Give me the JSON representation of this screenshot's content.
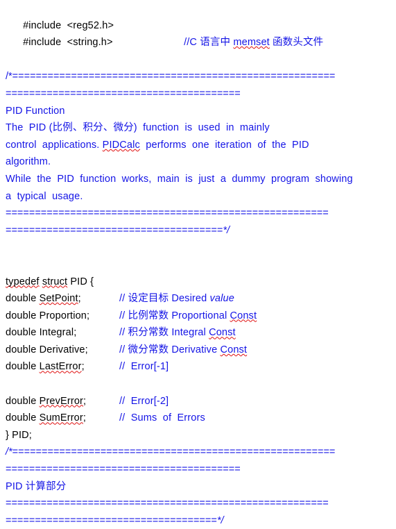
{
  "document": {
    "type": "c-source-code-document",
    "foreground_color": "#000000",
    "comment_color": "#1414e6",
    "spellcheck_underline_color": "#e01010",
    "background_color": "#ffffff"
  },
  "includes": {
    "line1": "#include  <reg52.h>",
    "line2": "#include  <string.h>",
    "line2_comment_prefix": "//C",
    "line2_comment_mid": " 语言中 ",
    "line2_comment_word": "memset",
    "line2_comment_suffix": " 函数头文件"
  },
  "header_comment": {
    "open": "/*",
    "rule_long": "=======================================================",
    "rule_short": "========================================",
    "title": "PID Function",
    "body_line1": "The  PID (比例、积分、微分)  function  is  used  in  mainly",
    "body_line2_a": "control  applications. ",
    "body_line2_word": "PIDCalc",
    "body_line2_b": "  performs  one  iteration  of  the  PID",
    "body_line3": "algorithm.",
    "body_line4": "While  the  PID  function  works,  main  is  just  a  dummy  program  showing",
    "body_line5": "a  typical  usage.",
    "close_rule_long": "=======================================================",
    "close_rule_short": "=====================================",
    "close": "*/"
  },
  "struct": {
    "typedef_kw": "typedef",
    "struct_kw": "struct",
    "name_line_rest": " PID {",
    "close_line": "} PID;",
    "fields": [
      {
        "type": "double ",
        "name": "SetPoint",
        "semi": ";",
        "spellcheck": true,
        "comment_slashes": "//",
        "comment_cn": " 设定目标 ",
        "comment_en": "Desired ",
        "comment_italic": "value",
        "comment_en2": "",
        "comment_en2_spellcheck": false
      },
      {
        "type": "double ",
        "name": "Proportion",
        "semi": ";",
        "spellcheck": false,
        "comment_slashes": "//",
        "comment_cn": " 比例常数 ",
        "comment_en": "Proportional ",
        "comment_italic": "",
        "comment_en2": "Const",
        "comment_en2_spellcheck": true
      },
      {
        "type": "double ",
        "name": "Integral",
        "semi": ";",
        "spellcheck": false,
        "comment_slashes": "//",
        "comment_cn": " 积分常数 ",
        "comment_en": "Integral ",
        "comment_italic": "",
        "comment_en2": "Const",
        "comment_en2_spellcheck": true
      },
      {
        "type": "double ",
        "name": "Derivative",
        "semi": ";",
        "spellcheck": false,
        "comment_slashes": "//",
        "comment_cn": " 微分常数 ",
        "comment_en": "Derivative ",
        "comment_italic": "",
        "comment_en2": "Const",
        "comment_en2_spellcheck": true
      },
      {
        "type": "double ",
        "name": "LastError",
        "semi": ";",
        "spellcheck": true,
        "comment_slashes": "//",
        "comment_cn": "  ",
        "comment_en": "Error[-1]",
        "comment_italic": "",
        "comment_en2": "",
        "comment_en2_spellcheck": false
      },
      {
        "type": "double ",
        "name": "PrevError",
        "semi": ";",
        "spellcheck": true,
        "comment_slashes": "//",
        "comment_cn": "  ",
        "comment_en": "Error[-2]",
        "comment_italic": "",
        "comment_en2": "",
        "comment_en2_spellcheck": false
      },
      {
        "type": "double ",
        "name": "SumError",
        "semi": ";",
        "spellcheck": true,
        "comment_slashes": "//",
        "comment_cn": "  ",
        "comment_en": "Sums  of  Errors",
        "comment_italic": "",
        "comment_en2": "",
        "comment_en2_spellcheck": false
      }
    ]
  },
  "footer_comment": {
    "open": "/*",
    "rule_long": "=======================================================",
    "rule_short": "========================================",
    "title": "PID 计算部分",
    "close_rule_long": "=======================================================",
    "close_rule_short": "====================================",
    "close": "*/"
  }
}
